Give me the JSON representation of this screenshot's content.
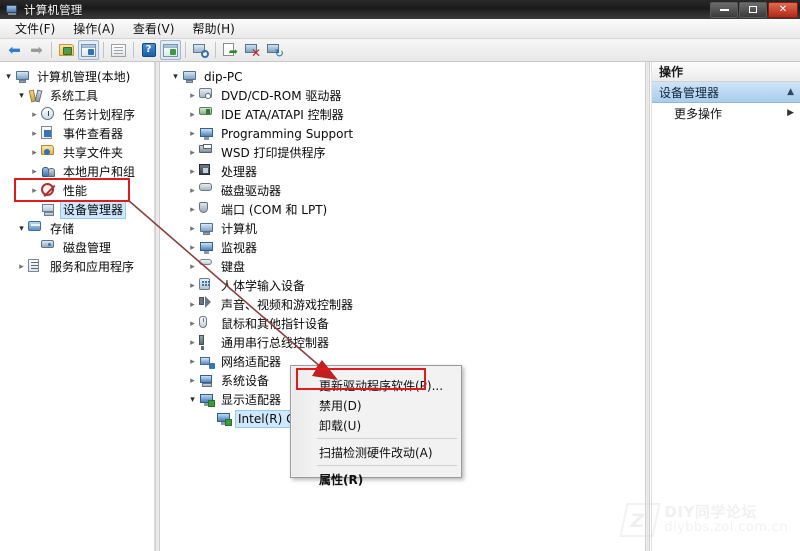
{
  "window": {
    "title": "计算机管理",
    "icon": "computer-management-icon",
    "controls": {
      "minimize": "最小化",
      "maximize": "最大化",
      "close": "关闭"
    }
  },
  "menubar": {
    "items": [
      {
        "label": "文件(F)",
        "name": "menu-file"
      },
      {
        "label": "操作(A)",
        "name": "menu-action"
      },
      {
        "label": "查看(V)",
        "name": "menu-view"
      },
      {
        "label": "帮助(H)",
        "name": "menu-help"
      }
    ]
  },
  "toolbar": {
    "buttons": [
      {
        "name": "back-arrow-icon",
        "icon": "arrow-left"
      },
      {
        "name": "forward-arrow-icon",
        "icon": "arrow-right"
      },
      {
        "name": "up-one-level-icon",
        "icon": "folder-up"
      },
      {
        "name": "show-hide-tree-icon",
        "icon": "window-pane"
      },
      {
        "name": "properties-icon",
        "icon": "properties-page"
      },
      {
        "name": "help-icon",
        "icon": "question-mark"
      },
      {
        "name": "show-action-pane-icon",
        "icon": "window-pane-green"
      },
      {
        "name": "scan-hardware-icon",
        "icon": "monitor-magnifier"
      },
      {
        "name": "update-driver-icon",
        "icon": "page-green-arrow"
      },
      {
        "name": "uninstall-device-icon",
        "icon": "device-red-x"
      },
      {
        "name": "refresh-device-icon",
        "icon": "device-refresh"
      }
    ]
  },
  "sidebar": {
    "items": [
      {
        "label": "计算机管理(本地)",
        "indent": 0,
        "expander": "expanded",
        "icon": "computer-icon",
        "name": "tree-computer-management-local"
      },
      {
        "label": "系统工具",
        "indent": 1,
        "expander": "expanded",
        "icon": "system-tools-icon",
        "name": "tree-system-tools"
      },
      {
        "label": "任务计划程序",
        "indent": 2,
        "expander": "collapsed",
        "icon": "task-scheduler-icon",
        "name": "tree-task-scheduler"
      },
      {
        "label": "事件查看器",
        "indent": 2,
        "expander": "collapsed",
        "icon": "event-viewer-icon",
        "name": "tree-event-viewer"
      },
      {
        "label": "共享文件夹",
        "indent": 2,
        "expander": "collapsed",
        "icon": "shared-folders-icon",
        "name": "tree-shared-folders"
      },
      {
        "label": "本地用户和组",
        "indent": 2,
        "expander": "collapsed",
        "icon": "local-users-icon",
        "name": "tree-local-users-and-groups"
      },
      {
        "label": "性能",
        "indent": 2,
        "expander": "collapsed",
        "icon": "performance-icon",
        "name": "tree-performance"
      },
      {
        "label": "设备管理器",
        "indent": 2,
        "expander": "blank",
        "icon": "device-manager-icon",
        "name": "tree-device-manager",
        "highlighted": true
      },
      {
        "label": "存储",
        "indent": 1,
        "expander": "expanded",
        "icon": "storage-icon",
        "name": "tree-storage"
      },
      {
        "label": "磁盘管理",
        "indent": 2,
        "expander": "blank",
        "icon": "disk-management-icon",
        "name": "tree-disk-management"
      },
      {
        "label": "服务和应用程序",
        "indent": 1,
        "expander": "collapsed",
        "icon": "services-icon",
        "name": "tree-services-and-applications"
      }
    ]
  },
  "device_tree": {
    "items": [
      {
        "label": "dip-PC",
        "indent": 0,
        "expander": "expanded",
        "icon": "computer-icon",
        "name": "device-node-dip-pc"
      },
      {
        "label": "DVD/CD-ROM 驱动器",
        "indent": 1,
        "expander": "collapsed",
        "icon": "dvd-drive-icon",
        "name": "device-node-dvd-cdrom"
      },
      {
        "label": "IDE ATA/ATAPI 控制器",
        "indent": 1,
        "expander": "collapsed",
        "icon": "ide-controller-icon",
        "name": "device-node-ide-ata-atapi"
      },
      {
        "label": "Programming Support",
        "indent": 1,
        "expander": "collapsed",
        "icon": "monitor-icon",
        "name": "device-node-programming-support"
      },
      {
        "label": "WSD 打印提供程序",
        "indent": 1,
        "expander": "collapsed",
        "icon": "printer-icon",
        "name": "device-node-wsd-print-provider"
      },
      {
        "label": "处理器",
        "indent": 1,
        "expander": "collapsed",
        "icon": "processor-icon",
        "name": "device-node-processors"
      },
      {
        "label": "磁盘驱动器",
        "indent": 1,
        "expander": "collapsed",
        "icon": "disk-drive-icon",
        "name": "device-node-disk-drives"
      },
      {
        "label": "端口 (COM 和 LPT)",
        "indent": 1,
        "expander": "collapsed",
        "icon": "port-icon",
        "name": "device-node-ports"
      },
      {
        "label": "计算机",
        "indent": 1,
        "expander": "collapsed",
        "icon": "computer-icon",
        "name": "device-node-computer"
      },
      {
        "label": "监视器",
        "indent": 1,
        "expander": "collapsed",
        "icon": "monitor-icon",
        "name": "device-node-monitors"
      },
      {
        "label": "键盘",
        "indent": 1,
        "expander": "collapsed",
        "icon": "keyboard-icon",
        "name": "device-node-keyboards"
      },
      {
        "label": "人体学输入设备",
        "indent": 1,
        "expander": "collapsed",
        "icon": "hid-icon",
        "name": "device-node-hid"
      },
      {
        "label": "声音、视频和游戏控制器",
        "indent": 1,
        "expander": "collapsed",
        "icon": "sound-icon",
        "name": "device-node-sound-video-game"
      },
      {
        "label": "鼠标和其他指针设备",
        "indent": 1,
        "expander": "collapsed",
        "icon": "mouse-icon",
        "name": "device-node-mice"
      },
      {
        "label": "通用串行总线控制器",
        "indent": 1,
        "expander": "collapsed",
        "icon": "usb-icon",
        "name": "device-node-usb-controllers"
      },
      {
        "label": "网络适配器",
        "indent": 1,
        "expander": "collapsed",
        "icon": "network-adapter-icon",
        "name": "device-node-network-adapters"
      },
      {
        "label": "系统设备",
        "indent": 1,
        "expander": "collapsed",
        "icon": "system-device-icon",
        "name": "device-node-system-devices"
      },
      {
        "label": "显示适配器",
        "indent": 1,
        "expander": "expanded",
        "icon": "display-adapter-icon",
        "name": "device-node-display-adapters"
      },
      {
        "label": "Intel(R) G41 E",
        "indent": 2,
        "expander": "blank",
        "icon": "display-adapter-icon",
        "name": "device-node-intel-g41",
        "selected": true
      }
    ]
  },
  "actions_pane": {
    "header": "操作",
    "section": "设备管理器",
    "section_chevron": "▲",
    "items": [
      {
        "label": "更多操作",
        "submenu_arrow": "▶",
        "name": "action-more-actions"
      }
    ]
  },
  "context_menu": {
    "items": [
      {
        "label": "",
        "type": "partial",
        "name": "ctx-item-partial-top"
      },
      {
        "label": "更新驱动程序软件(P)...",
        "type": "item",
        "name": "ctx-update-driver-software",
        "highlighted": true
      },
      {
        "label": "禁用(D)",
        "type": "item",
        "name": "ctx-disable"
      },
      {
        "label": "卸载(U)",
        "type": "item",
        "name": "ctx-uninstall"
      },
      {
        "label": "",
        "type": "separator",
        "name": "ctx-separator-1"
      },
      {
        "label": "扫描检测硬件改动(A)",
        "type": "item",
        "name": "ctx-scan-hardware-changes"
      },
      {
        "label": "",
        "type": "separator",
        "name": "ctx-separator-2"
      },
      {
        "label": "属性(R)",
        "type": "item-bold",
        "name": "ctx-properties"
      }
    ]
  },
  "annotations": {
    "highlight_color": "#e01b1b",
    "arrow_color": "#8c4040",
    "boxes": [
      {
        "name": "redbox-device-manager",
        "target": "设备管理器"
      },
      {
        "name": "redbox-update-driver",
        "target": "更新驱动程序软件(P)..."
      }
    ]
  },
  "watermark": {
    "line1": "DIY同学论坛",
    "line2": "diybbs.zol.com.cn",
    "logo_letter": "Z"
  }
}
